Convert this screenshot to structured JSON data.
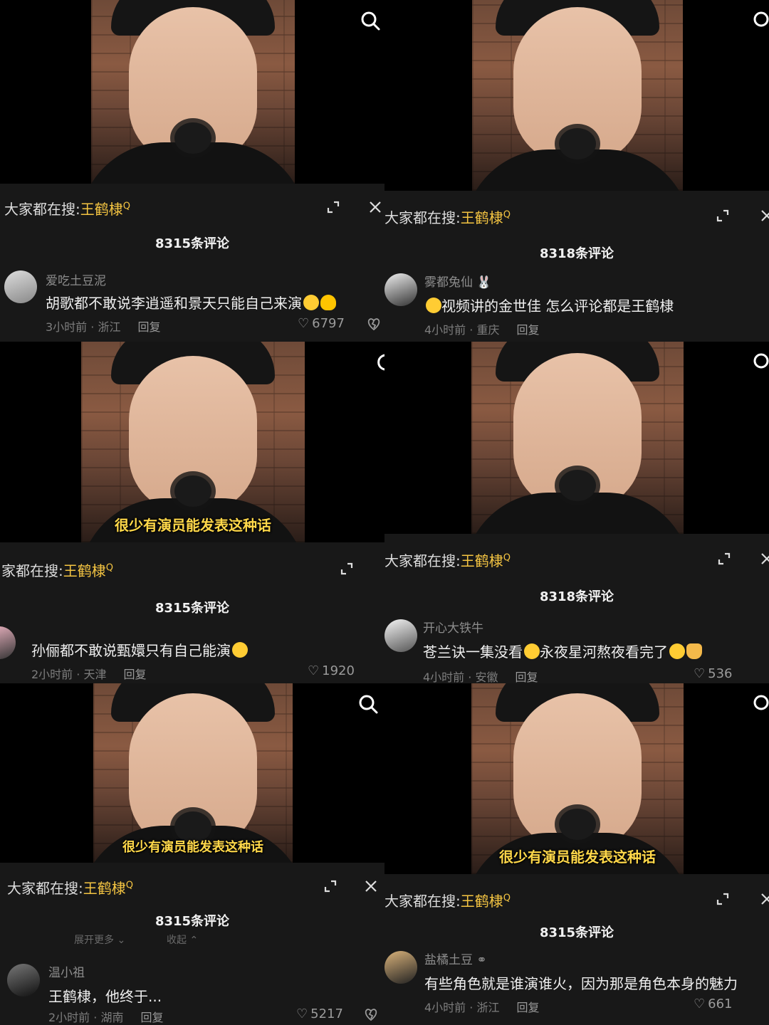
{
  "colors": {
    "keyword": "#f5c542",
    "subtitle": "#ffd84a",
    "panel": "#181818"
  },
  "tiles": [
    {
      "trending_prefix": "大家都在搜:",
      "trending_keyword": "王鹤棣",
      "comment_count": "8315条评论",
      "username": "爱吃土豆泥",
      "comment": "胡歌都不敢说李逍遥和景天只能自己来演",
      "time_location": "3小时前 · 浙江",
      "reply": "回复",
      "likes": "6797",
      "subtitle": ""
    },
    {
      "trending_prefix": "大家都在搜:",
      "trending_keyword": "王鹤棣",
      "comment_count": "8318条评论",
      "username": "雾都兔仙",
      "comment": "视频讲的金世佳 怎么评论都是王鹤棣",
      "time_location": "4小时前 · 重庆",
      "reply": "回复",
      "likes": "",
      "subtitle": ""
    },
    {
      "trending_prefix": "家都在搜:",
      "trending_keyword": "王鹤棣",
      "comment_count": "8315条评论",
      "username": "",
      "comment": "孙俪都不敢说甄嬛只有自己能演",
      "time_location": "2小时前 · 天津",
      "reply": "回复",
      "likes": "1920",
      "subtitle": "很少有演员能发表这种话"
    },
    {
      "trending_prefix": "大家都在搜:",
      "trending_keyword": "王鹤棣",
      "comment_count": "8318条评论",
      "username": "开心大铁牛",
      "comment_a": "苍兰诀一集没看",
      "comment_b": "永夜星河熬夜看完了",
      "time_location": "4小时前 · 安徽",
      "reply": "回复",
      "likes": "536",
      "subtitle": ""
    },
    {
      "trending_prefix": "大家都在搜:",
      "trending_keyword": "王鹤棣",
      "comment_count": "8315条评论",
      "expand_more": "展开更多 ⌄",
      "collapse": "收起 ⌃",
      "username": "温小祖",
      "comment": "王鹤棣，他终于...",
      "time_location": "2小时前 · 湖南",
      "reply": "回复",
      "likes": "5217",
      "subtitle": "很少有演员能发表这种话"
    },
    {
      "trending_prefix": "大家都在搜:",
      "trending_keyword": "王鹤棣",
      "comment_count": "8315条评论",
      "username": "盐橘土豆",
      "comment": "有些角色就是谁演谁火，因为那是角色本身的魅力",
      "time_location": "4小时前 · 浙江",
      "reply": "回复",
      "likes": "661",
      "subtitle": "很少有演员能发表这种话"
    }
  ]
}
